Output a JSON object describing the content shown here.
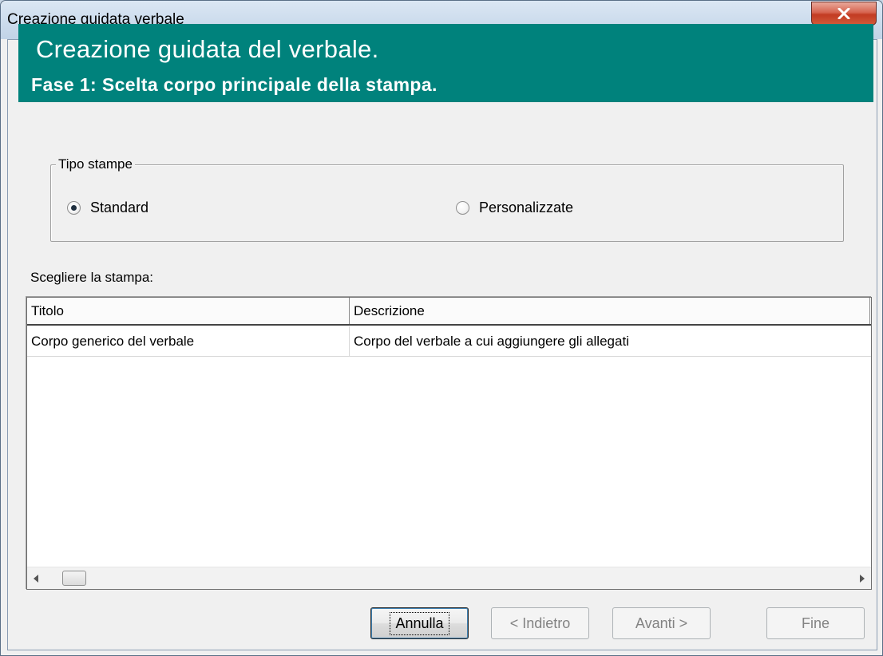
{
  "window": {
    "title": "Creazione guidata verbale",
    "close_label": "X"
  },
  "banner": {
    "title": "Creazione guidata del verbale.",
    "subtitle": "Fase 1: Scelta corpo principale della stampa."
  },
  "print_type": {
    "legend": "Tipo stampe",
    "options": [
      {
        "label": "Standard",
        "checked": true
      },
      {
        "label": "Personalizzate",
        "checked": false
      }
    ]
  },
  "list": {
    "label": "Scegliere la stampa:",
    "columns": [
      "Titolo",
      "Descrizione"
    ],
    "rows": [
      [
        "Corpo generico del verbale",
        "Corpo del verbale a cui aggiungere gli allegati"
      ]
    ]
  },
  "buttons": {
    "cancel": "Annulla",
    "back": "< Indietro",
    "next": "Avanti >",
    "finish": "Fine"
  },
  "colors": {
    "banner": "#00827c",
    "close_button": "#c23b22"
  }
}
